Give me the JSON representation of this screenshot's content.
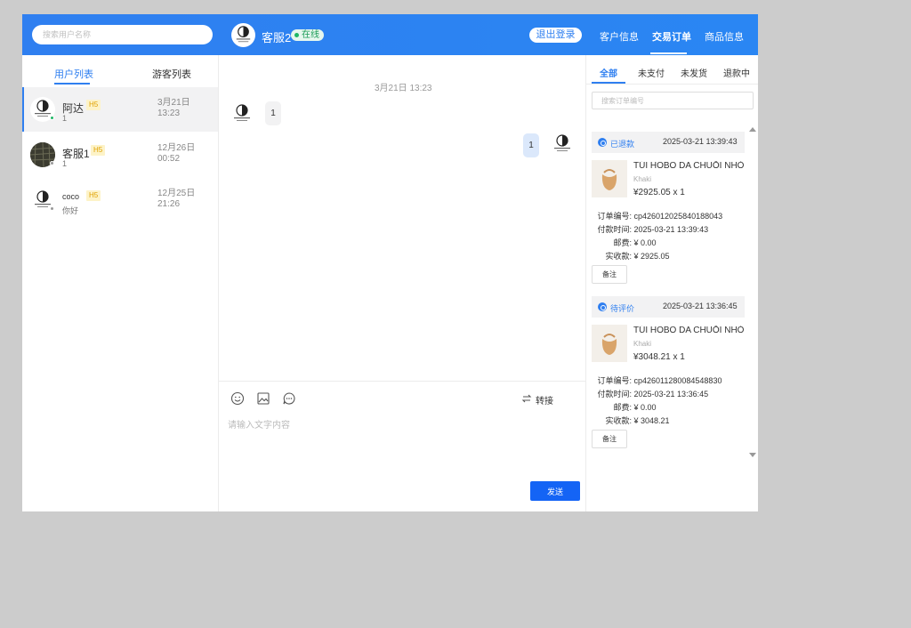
{
  "header": {
    "search_placeholder": "搜索用户名称",
    "agent_name": "客服2",
    "status": "在线",
    "logout_label": "退出登录",
    "nav": [
      "客户信息",
      "交易订单",
      "商品信息"
    ]
  },
  "left": {
    "tabs": [
      "用户列表",
      "游客列表"
    ],
    "users": [
      {
        "name": "阿达",
        "tag": "H5",
        "last_msg": "1",
        "date": "3月21日",
        "time": "13:23"
      },
      {
        "name": "客服1",
        "tag": "H5",
        "last_msg": "1",
        "date": "12月26日",
        "time": "00:52"
      },
      {
        "name": "coco",
        "tag": "H5",
        "last_msg": "你好",
        "date": "12月25日",
        "time": "21:26"
      }
    ]
  },
  "chat": {
    "date": "3月21日 13:23",
    "messages": [
      {
        "side": "left",
        "text": "1"
      },
      {
        "side": "right",
        "text": "1"
      }
    ],
    "transfer_label": "转接",
    "input_placeholder": "请输入文字内容",
    "send_label": "发送"
  },
  "orders": {
    "tabs": [
      "全部",
      "未支付",
      "未发货",
      "退款中"
    ],
    "search_placeholder": "搜索订单编号",
    "labels": {
      "order_no": "订单编号:",
      "pay_time": "付款时间:",
      "shipping": "邮费:",
      "paid": "实收款:",
      "note": "备注"
    },
    "list": [
      {
        "status": "已退款",
        "datetime": "2025-03-21 13:39:43",
        "title": "TÚI HOBO DA CHUỖI NHỎ",
        "variant": "Khaki",
        "price_qty": "¥2925.05 x 1",
        "order_no": "cp426012025840188043",
        "pay_time": "2025-03-21 13:39:43",
        "shipping": "¥ 0.00",
        "paid": "¥ 2925.05"
      },
      {
        "status": "待评价",
        "datetime": "2025-03-21 13:36:45",
        "title": "TÚI HOBO DA CHUỖI NHỎ",
        "variant": "Khaki",
        "price_qty": "¥3048.21 x 1",
        "order_no": "cp426011280084548830",
        "pay_time": "2025-03-21 13:36:45",
        "shipping": "¥ 0.00",
        "paid": "¥ 3048.21"
      }
    ]
  },
  "colors": {
    "primary": "#2f7ff0",
    "send": "#1464f5",
    "online": "#1fb866",
    "tag_bg": "#fdf3c8",
    "tag_text": "#e0a100"
  },
  "icons": [
    "emoji-icon",
    "image-icon",
    "chat-bubble-icon",
    "transfer-icon",
    "status-icon"
  ]
}
